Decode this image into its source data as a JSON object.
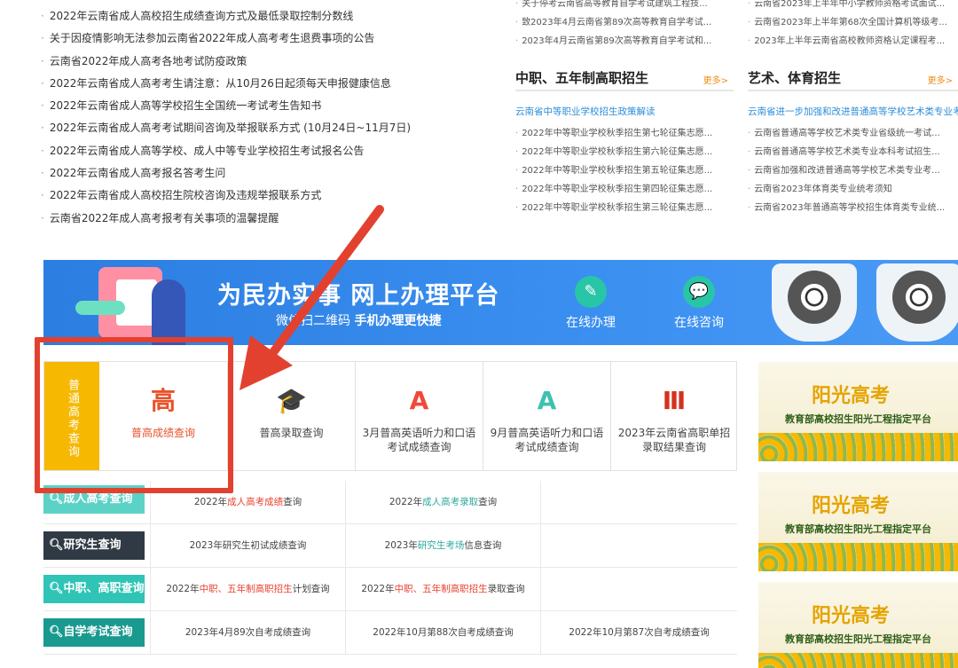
{
  "news": [
    "2022年云南省成人高校招生成绩查询方式及最低录取控制分数线",
    "关于因疫情影响无法参加云南省2022年成人高考考生退费事项的公告",
    "云南省2022年成人高考各地考试防疫政策",
    "2022年云南省成人高考考生请注意：从10月26日起须每天申报健康信息",
    "2022年云南省成人高等学校招生全国统一考试考生告知书",
    "2022年云南省成人高考考试期间咨询及举报联系方式  (10月24日~11月7日)",
    "2022年云南省成人高等学校、成人中等专业学校招生考试报名公告",
    "2022年云南省成人高考报名答考生问",
    "2022年云南省成人高校招生院校咨询及违规举报联系方式",
    "云南省2022年成人高考报考有关事项的温馨提醒"
  ],
  "mid_top": [
    "关于停考云南省高等教育自学考试建筑工程技...",
    "致2023年4月云南省第89次高等教育自学考试...",
    "2023年4月云南省第89次高等教育自学考试和..."
  ],
  "right_top": [
    "云南省2023年上半年中小学教师资格考试面试...",
    "云南省2023年上半年第68次全国计算机等级考...",
    "2023年上半年云南省高校教师资格认定课程考..."
  ],
  "mid_section": {
    "title": "中职、五年制高职招生",
    "more": "更多>",
    "sub": "云南省中等职业学校招生政策解读",
    "items": [
      "2022年中等职业学校秋季招生第七轮征集志愿...",
      "2022年中等职业学校秋季招生第六轮征集志愿...",
      "2022年中等职业学校秋季招生第五轮征集志愿...",
      "2022年中等职业学校秋季招生第四轮征集志愿...",
      "2022年中等职业学校秋季招生第三轮征集志愿..."
    ]
  },
  "right_section": {
    "title": "艺术、体育招生",
    "more": "更多>",
    "sub": "云南省进一步加强和改进普通高等学校艺术类专业考",
    "items": [
      "云南省普通高等学校艺术类专业省级统一考试...",
      "云南省普通高等学校艺术类专业本科考试招生...",
      "云南省加强和改进普通高等学校艺术类专业考...",
      "云南省2023年体育类专业统考须知",
      "云南省2023年普通高等学校招生体育类专业统..."
    ]
  },
  "banner": {
    "title": "为民办实事 网上办理平台",
    "sub_prefix": "微信扫二维码",
    "sub_bold": "手机办理更快捷",
    "btn_online": "在线办理",
    "btn_consult": "在线咨询",
    "icon_online": "edit-icon",
    "icon_consult": "chat-icon"
  },
  "query": {
    "side_label": "普通高考查询",
    "items": [
      {
        "label": "普高成绩查询",
        "icon": "高"
      },
      {
        "label": "普高录取查询",
        "icon": "🎓"
      },
      {
        "label": "3月普高英语听力和口语考试成绩查询",
        "icon": "A"
      },
      {
        "label": "9月普高英语听力和口语考试成绩查询",
        "icon": "A"
      },
      {
        "label": "2023年云南省高职单招录取结果查询",
        "icon": "Ⅲ"
      }
    ]
  },
  "rows": [
    {
      "tag": "成人高考查询",
      "c1_pre": "2022年",
      "c1_hl": "成人高考成绩",
      "c1_post": "查询",
      "c2_pre": "2022年",
      "c2_hl": "成人高考录取",
      "c2_post": "查询",
      "c3": ""
    },
    {
      "tag": "研究生查询",
      "c1_pre": "2023年研究生初试成绩查询",
      "c1_hl": "",
      "c1_post": "",
      "c2_pre": "2023年",
      "c2_hl": "研究生考场",
      "c2_post": "信息查询",
      "c3": ""
    },
    {
      "tag": "中职、高职查询",
      "c1_pre": "2022年",
      "c1_hl": "中职、五年制高职招生",
      "c1_post": "计划查询",
      "c2_pre": "2022年",
      "c2_hl": "中职、五年制高职招生",
      "c2_post": "录取查询",
      "c3": ""
    },
    {
      "tag": "自学考试查询",
      "c1_pre": "2023年4月89次自考成绩查询",
      "c1_hl": "",
      "c1_post": "",
      "c2_pre": "2022年10月第88次自考成绩查询",
      "c2_hl": "",
      "c2_post": "",
      "c3": "2022年10月第87次自考成绩查询"
    }
  ],
  "ads": [
    {
      "title": "阳光高考",
      "sub": "教育部高校招生阳光工程指定平台"
    },
    {
      "title": "阳光高考",
      "sub": "教育部高校招生阳光工程指定平台"
    },
    {
      "title": "阳光高考",
      "sub": "教育部高校招生阳光工程指定平台"
    }
  ],
  "colors": {
    "highlight": "#e3412f",
    "banner": "#2c7ee0",
    "accent_orange": "#f6b800"
  }
}
